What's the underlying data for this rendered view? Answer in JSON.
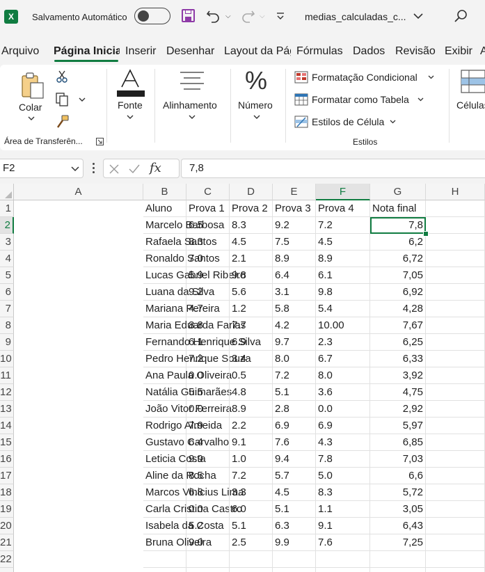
{
  "titlebar": {
    "app_icon": "X",
    "autosave_label": "Salvamento Automático",
    "autosave_state": "off",
    "filename": "medias_calculadas_c...",
    "icons": [
      "toggle-switch",
      "save-icon",
      "undo-icon",
      "redo-icon",
      "customize-qat-icon",
      "chevron-down-icon",
      "search-icon"
    ]
  },
  "tabs": [
    "Arquivo",
    "Página Inicial",
    "Inserir",
    "Desenhar",
    "Layout da Página",
    "Fórmulas",
    "Dados",
    "Revisão",
    "Exibir",
    "Ajuda"
  ],
  "active_tab": "Página Inicial",
  "ribbon": {
    "clipboard": {
      "paste_label": "Colar",
      "group_label": "Área de Transferên..."
    },
    "font": {
      "label": "Fonte"
    },
    "alignment": {
      "label": "Alinhamento"
    },
    "number": {
      "label": "Número"
    },
    "styles": {
      "conditional": "Formatação Condicional",
      "table": "Formatar como Tabela",
      "cell_styles": "Estilos de Célula",
      "group_label": "Estilos"
    },
    "cells": {
      "label": "Células"
    }
  },
  "formula_bar": {
    "name_box": "F2",
    "fx_label": "fx",
    "value": "7,8"
  },
  "sheet": {
    "columns": [
      "A",
      "B",
      "C",
      "D",
      "E",
      "F",
      "G",
      "H"
    ],
    "selected_column": "F",
    "selected_row": "2",
    "row_numbers": [
      "1",
      "2",
      "3",
      "4",
      "5",
      "6",
      "7",
      "8",
      "9",
      "10",
      "11",
      "12",
      "13",
      "14",
      "15",
      "16",
      "17",
      "18",
      "19",
      "20",
      "21",
      "22",
      "23"
    ],
    "header": [
      "Aluno",
      "Prova 1",
      "Prova 2",
      "Prova 3",
      "Prova 4",
      "Nota final"
    ],
    "rows": [
      [
        "Marcelo Barbosa",
        "6.5",
        "8.3",
        "9.2",
        "7.2",
        "7,8"
      ],
      [
        "Rafaela Santos",
        "8.3",
        "4.5",
        "7.5",
        "4.5",
        "6,2"
      ],
      [
        "Ronaldo Santos",
        "7.0",
        "2.1",
        "8.9",
        "8.9",
        "6,72"
      ],
      [
        "Lucas Gabriel Ribeiro",
        "5.9",
        "9.8",
        "6.4",
        "6.1",
        "7,05"
      ],
      [
        "Luana da Silva",
        "9.2",
        "5.6",
        "3.1",
        "9.8",
        "6,92"
      ],
      [
        "Mariana Pereira",
        "4.7",
        "1.2",
        "5.8",
        "5.4",
        "4,28"
      ],
      [
        "Maria Eduarda Farias",
        "8.8",
        "7.7",
        "4.2",
        "10.00",
        "7,67"
      ],
      [
        "Fernando Henrique Silva",
        "6.1",
        "6.9",
        "9.7",
        "2.3",
        "6,25"
      ],
      [
        "Pedro Henrique Souza",
        "7.2",
        "3.4",
        "8.0",
        "6.7",
        "6,33"
      ],
      [
        "Ana Paula Oliveira",
        "0.0",
        "0.5",
        "7.2",
        "8.0",
        "3,92"
      ],
      [
        "Natália Guimarães",
        "5.5",
        "4.8",
        "5.1",
        "3.6",
        "4,75"
      ],
      [
        "João Vitor Ferreira",
        "0.0",
        "8.9",
        "2.8",
        "0.0",
        "2,92"
      ],
      [
        "Rodrigo Almeida",
        "7.9",
        "2.2",
        "6.9",
        "6.9",
        "5,97"
      ],
      [
        "Gustavo Carvalho",
        "6.4",
        "9.1",
        "7.6",
        "4.3",
        "6,85"
      ],
      [
        "Leticia Costa",
        "9.9",
        "1.0",
        "9.4",
        "7.8",
        "7,03"
      ],
      [
        "Aline da Rocha",
        "8.5",
        "7.2",
        "5.7",
        "5.0",
        "6,6"
      ],
      [
        "Marcos Vinicius Lima",
        "6.8",
        "3.3",
        "4.5",
        "8.3",
        "5,72"
      ],
      [
        "Carla Cristina Castro",
        "0.0",
        "6.0",
        "5.1",
        "1.1",
        "3,05"
      ],
      [
        "Isabela da Costa",
        "5.2",
        "5.1",
        "6.3",
        "9.1",
        "6,43"
      ],
      [
        "Bruna Oliveira",
        "9.0",
        "2.5",
        "9.9",
        "7.6",
        "7,25"
      ]
    ]
  },
  "colors": {
    "accent": "#107c41",
    "save_icon": "#8e3aa7",
    "styles_icon": "#c0392b"
  }
}
